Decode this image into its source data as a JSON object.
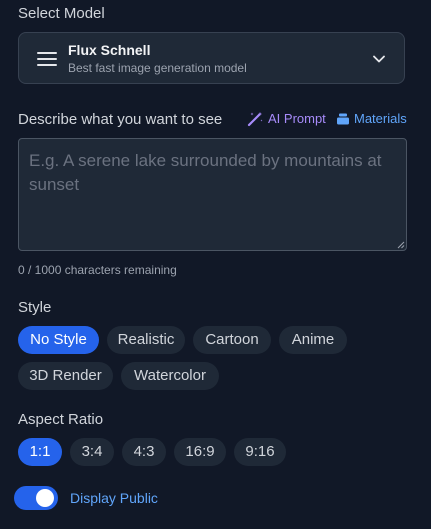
{
  "model_section": {
    "label": "Select Model",
    "selected_name": "Flux Schnell",
    "selected_description": "Best fast image generation model"
  },
  "prompt_section": {
    "label": "Describe what you want to see",
    "ai_prompt_label": "AI Prompt",
    "materials_label": "Materials",
    "value": "",
    "placeholder": "E.g. A serene lake surrounded by mountains at sunset",
    "char_count": "0 / 1000 characters remaining"
  },
  "style_section": {
    "label": "Style",
    "options": [
      "No Style",
      "Realistic",
      "Cartoon",
      "Anime",
      "3D Render",
      "Watercolor"
    ],
    "selected": "No Style"
  },
  "aspect_section": {
    "label": "Aspect Ratio",
    "options": [
      "1:1",
      "3:4",
      "4:3",
      "16:9",
      "9:16"
    ],
    "selected": "1:1"
  },
  "display_public": {
    "label": "Display Public",
    "enabled": true
  },
  "colors": {
    "background": "#111827",
    "accent": "#2563eb",
    "ai_prompt": "#a78bfa",
    "materials": "#60a5fa"
  },
  "icons": {
    "model": "menu-icon",
    "dropdown": "chevron-down-icon",
    "ai_prompt": "magic-wand-icon",
    "materials": "stack-icon"
  }
}
